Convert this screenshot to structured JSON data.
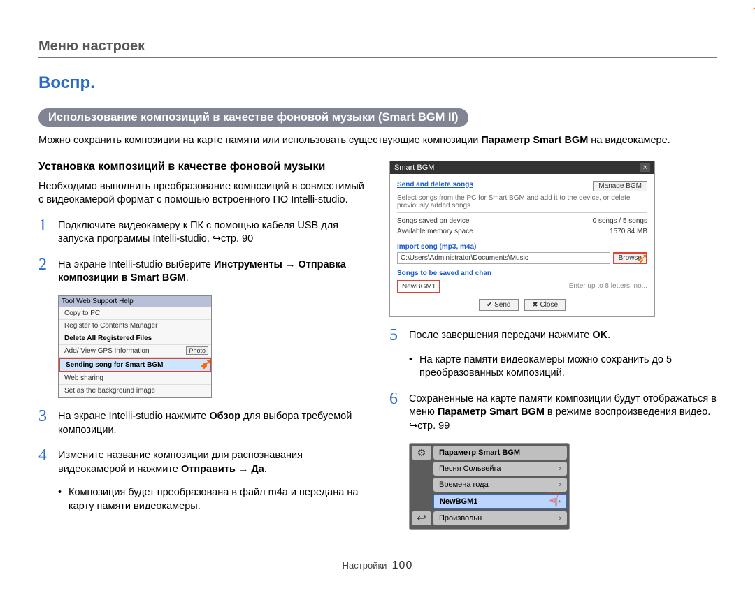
{
  "header": {
    "breadcrumb": "Меню настроек"
  },
  "title": "Воспр.",
  "pill": "Использование композиций в качестве фоновой музыки (Smart BGM II)",
  "intro_a": "Можно сохранить композиции на карте памяти или использовать существующие композиции ",
  "intro_b": "Параметр Smart BGM",
  "intro_c": " на видеокамере.",
  "left": {
    "subhead": "Установка композиций в качестве фоновой музыки",
    "para": "Необходимо выполнить преобразование композиций в совместимый с видеокамерой формат с помощью встроенного ПО Intelli-studio.",
    "step1": "Подключите видеокамеру к ПК с помощью кабеля USB для запуска программы Intelli-studio. ↪стр. 90",
    "step2_a": "На экране Intelli-studio выберите ",
    "step2_b": "Инструменты",
    "step2_c": " → ",
    "step2_d": "Отправка композиции в Smart BGM",
    "step2_e": ".",
    "step3_a": "На экране Intelli-studio нажмите ",
    "step3_b": "Обзор",
    "step3_c": " для выбора требуемой композиции.",
    "step4_a": "Измените название композиции для распознавания видеокамерой и нажмите ",
    "step4_b": "Отправить",
    "step4_c": " → ",
    "step4_d": "Да",
    "step4_e": ".",
    "step4_bullet": "Композиция будет преобразована в файл m4a и передана на карту памяти видеокамеры.",
    "toolmenu": {
      "tabs": "Tool   Web Support   Help",
      "items": [
        "Copy to PC",
        "Register to Contents Manager",
        "Delete All Registered Files",
        "Add/ View GPS Information",
        "Sending song for Smart BGM",
        "Web sharing",
        "Set as the background image"
      ],
      "right_tag": "Photo"
    }
  },
  "right": {
    "dialog": {
      "title": "Smart BGM",
      "link1": "Send and delete songs",
      "manage": "Manage BGM",
      "desc": "Select songs from the PC for Smart BGM and add it to the device, or delete previously added songs.",
      "row1_l": "Songs saved on device",
      "row1_r": "0 songs / 5 songs",
      "row2_l": "Available memory space",
      "row2_r": "1570.84 MB",
      "import_lbl": "Import song (mp3, m4a)",
      "import_path": "C:\\Users\\Administrator\\Documents\\Music",
      "browse": "Browse",
      "songs_lbl": "Songs to be saved and chan",
      "songs_val": "NewBGM1",
      "hint": "Enter up to 8 letters, no...",
      "send": "Send",
      "close": "Close"
    },
    "step5_a": "После завершения передачи нажмите ",
    "step5_b": "OK",
    "step5_c": ".",
    "step5_bullet": "На карте памяти видеокамеры можно сохранить до 5 преобразованных композиций.",
    "step6_a": "Сохраненные на карте памяти композиции будут отображаться в меню ",
    "step6_b": "Параметр Smart BGM",
    "step6_c": " в режиме воспроизведения видео. ↪стр. 99",
    "bgmlist": {
      "header": "Параметр Smart BGM",
      "items": [
        "Песня Сольвейга",
        "Времена года",
        "NewBGM1",
        "Произвольн"
      ]
    }
  },
  "footer": {
    "label": "Настройки",
    "page": "100"
  }
}
